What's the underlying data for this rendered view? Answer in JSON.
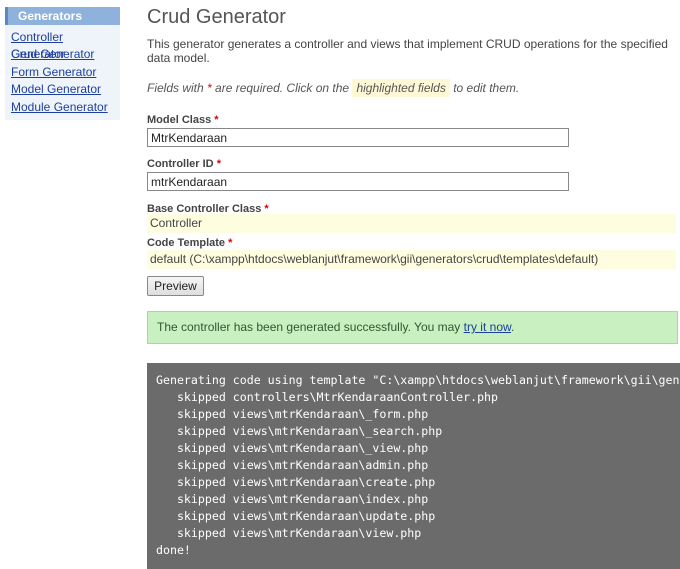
{
  "sidebar": {
    "header": "Generators",
    "items": [
      {
        "label": "Controller Generator"
      },
      {
        "label": "Crud Generator"
      },
      {
        "label": "Form Generator"
      },
      {
        "label": "Model Generator"
      },
      {
        "label": "Module Generator"
      }
    ]
  },
  "page": {
    "title": "Crud Generator",
    "description": "This generator generates a controller and views that implement CRUD operations for the specified data model.",
    "note": {
      "prefix": "Fields with ",
      "asterisk": "*",
      "middle": " are required. Click on the ",
      "highlight": "highlighted fields",
      "suffix": " to edit them."
    }
  },
  "form": {
    "model_class": {
      "label": "Model Class",
      "required": "*",
      "value": "MtrKendaraan"
    },
    "controller_id": {
      "label": "Controller ID",
      "required": "*",
      "value": "mtrKendaraan"
    },
    "base_controller": {
      "label": "Base Controller Class",
      "required": "*",
      "value": "Controller"
    },
    "code_template": {
      "label": "Code Template",
      "required": "*",
      "value": "default (C:\\xampp\\htdocs\\weblanjut\\framework\\gii\\generators\\crud\\templates\\default)"
    },
    "preview_button": "Preview"
  },
  "success": {
    "text": "The controller has been generated successfully. You may ",
    "link": "try it now",
    "end": "."
  },
  "console": {
    "lines": [
      "Generating code using template \"C:\\xampp\\htdocs\\weblanjut\\framework\\gii\\generators\\crud\\templates\\default\"...",
      "   skipped controllers\\MtrKendaraanController.php",
      "   skipped views\\mtrKendaraan\\_form.php",
      "   skipped views\\mtrKendaraan\\_search.php",
      "   skipped views\\mtrKendaraan\\_view.php",
      "   skipped views\\mtrKendaraan\\admin.php",
      "   skipped views\\mtrKendaraan\\create.php",
      "   skipped views\\mtrKendaraan\\index.php",
      "   skipped views\\mtrKendaraan\\update.php",
      "   skipped views\\mtrKendaraan\\view.php",
      "done!"
    ]
  },
  "colors": {
    "sidebar_header": "#8fb2dc",
    "link": "#1d3f9e",
    "success_bg": "#c8f0c0",
    "console_bg": "#6b6b6b",
    "sticky_bg": "#fffde0",
    "required": "#dd0000"
  }
}
